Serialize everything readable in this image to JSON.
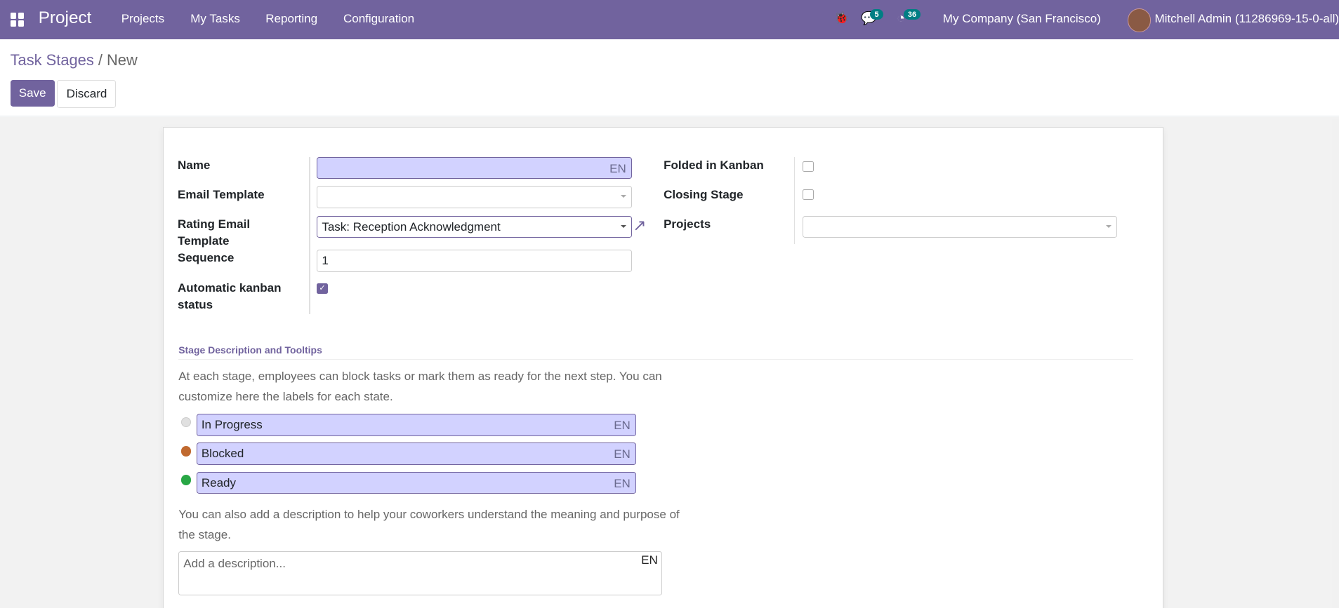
{
  "navbar": {
    "app_name": "Project",
    "menu": [
      "Projects",
      "My Tasks",
      "Reporting",
      "Configuration"
    ],
    "messages_count": "5",
    "activities_count": "36",
    "company": "My Company (San Francisco)",
    "user": "Mitchell Admin (11286969-15-0-all)"
  },
  "breadcrumb": {
    "parent": "Task Stages",
    "separator": "/",
    "current": "New"
  },
  "buttons": {
    "save": "Save",
    "discard": "Discard"
  },
  "form": {
    "name_label": "Name",
    "name_value": "",
    "lang": "EN",
    "email_template_label": "Email Template",
    "email_template_value": "",
    "rating_label_1": "Rating Email",
    "rating_label_2": "Template",
    "rating_value": "Task: Reception Acknowledgment",
    "sequence_label": "Sequence",
    "sequence_value": "1",
    "auto_kanban_label_1": "Automatic kanban",
    "auto_kanban_label_2": "status",
    "auto_kanban_checked": true,
    "folded_label": "Folded in Kanban",
    "folded_checked": false,
    "closing_label": "Closing Stage",
    "closing_checked": false,
    "projects_label": "Projects",
    "projects_value": ""
  },
  "section": {
    "title": "Stage Description and Tooltips",
    "intro_1": "At each stage, employees can block tasks or mark them as ready for the next step. You can",
    "intro_2": "customize here the labels for each state.",
    "states": [
      {
        "label": "In Progress",
        "color": "#e0e0e0"
      },
      {
        "label": "Blocked",
        "color": "#c0692f"
      },
      {
        "label": "Ready",
        "color": "#28a745"
      }
    ],
    "desc_1": "You can also add a description to help your coworkers understand the meaning and purpose of",
    "desc_2": "the stage.",
    "description_placeholder": "Add a description..."
  }
}
